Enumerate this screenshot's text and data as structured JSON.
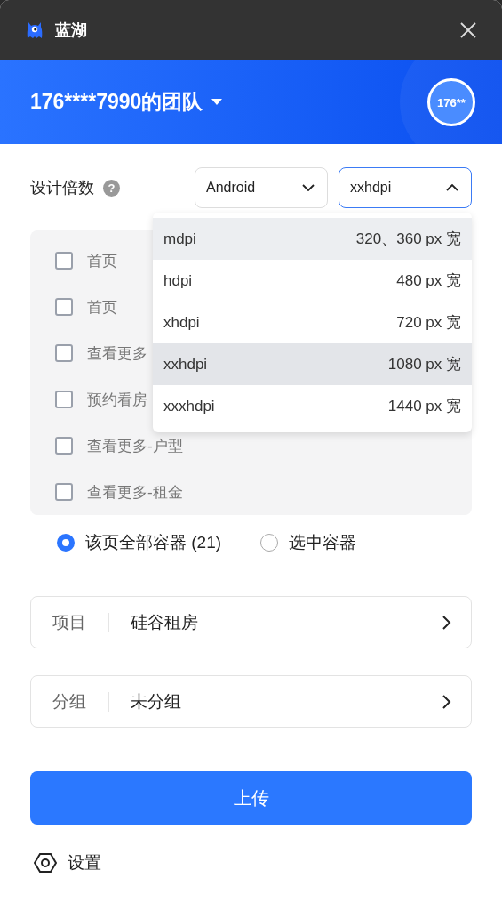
{
  "window": {
    "title": "蓝湖"
  },
  "team": {
    "name": "176****7990的团队",
    "avatar": "176**"
  },
  "scale": {
    "label": "设计倍数",
    "help": "?",
    "platform": "Android",
    "density": "xxhdpi",
    "density_open": true
  },
  "density_options": [
    {
      "name": "mdpi",
      "width": "320、360 px 宽",
      "selected": false,
      "hovered": true
    },
    {
      "name": "hdpi",
      "width": "480 px 宽",
      "selected": false,
      "hovered": false
    },
    {
      "name": "xhdpi",
      "width": "720 px 宽",
      "selected": false,
      "hovered": false
    },
    {
      "name": "xxhdpi",
      "width": "1080 px 宽",
      "selected": true,
      "hovered": false
    },
    {
      "name": "xxxhdpi",
      "width": "1440 px 宽",
      "selected": false,
      "hovered": false
    }
  ],
  "pages": [
    {
      "label": "首页",
      "checked": false
    },
    {
      "label": "首页",
      "checked": false
    },
    {
      "label": "查看更多",
      "checked": false
    },
    {
      "label": "预约看房",
      "checked": false
    },
    {
      "label": "查看更多-户型",
      "checked": false
    },
    {
      "label": "查看更多-租金",
      "checked": false
    }
  ],
  "scope": [
    {
      "label": "该页全部容器 (21)",
      "selected": true
    },
    {
      "label": "选中容器",
      "selected": false
    }
  ],
  "fields": [
    {
      "label": "项目",
      "value": "硅谷租房"
    },
    {
      "label": "分组",
      "value": "未分组"
    }
  ],
  "upload_button": "上传",
  "settings": "设置"
}
